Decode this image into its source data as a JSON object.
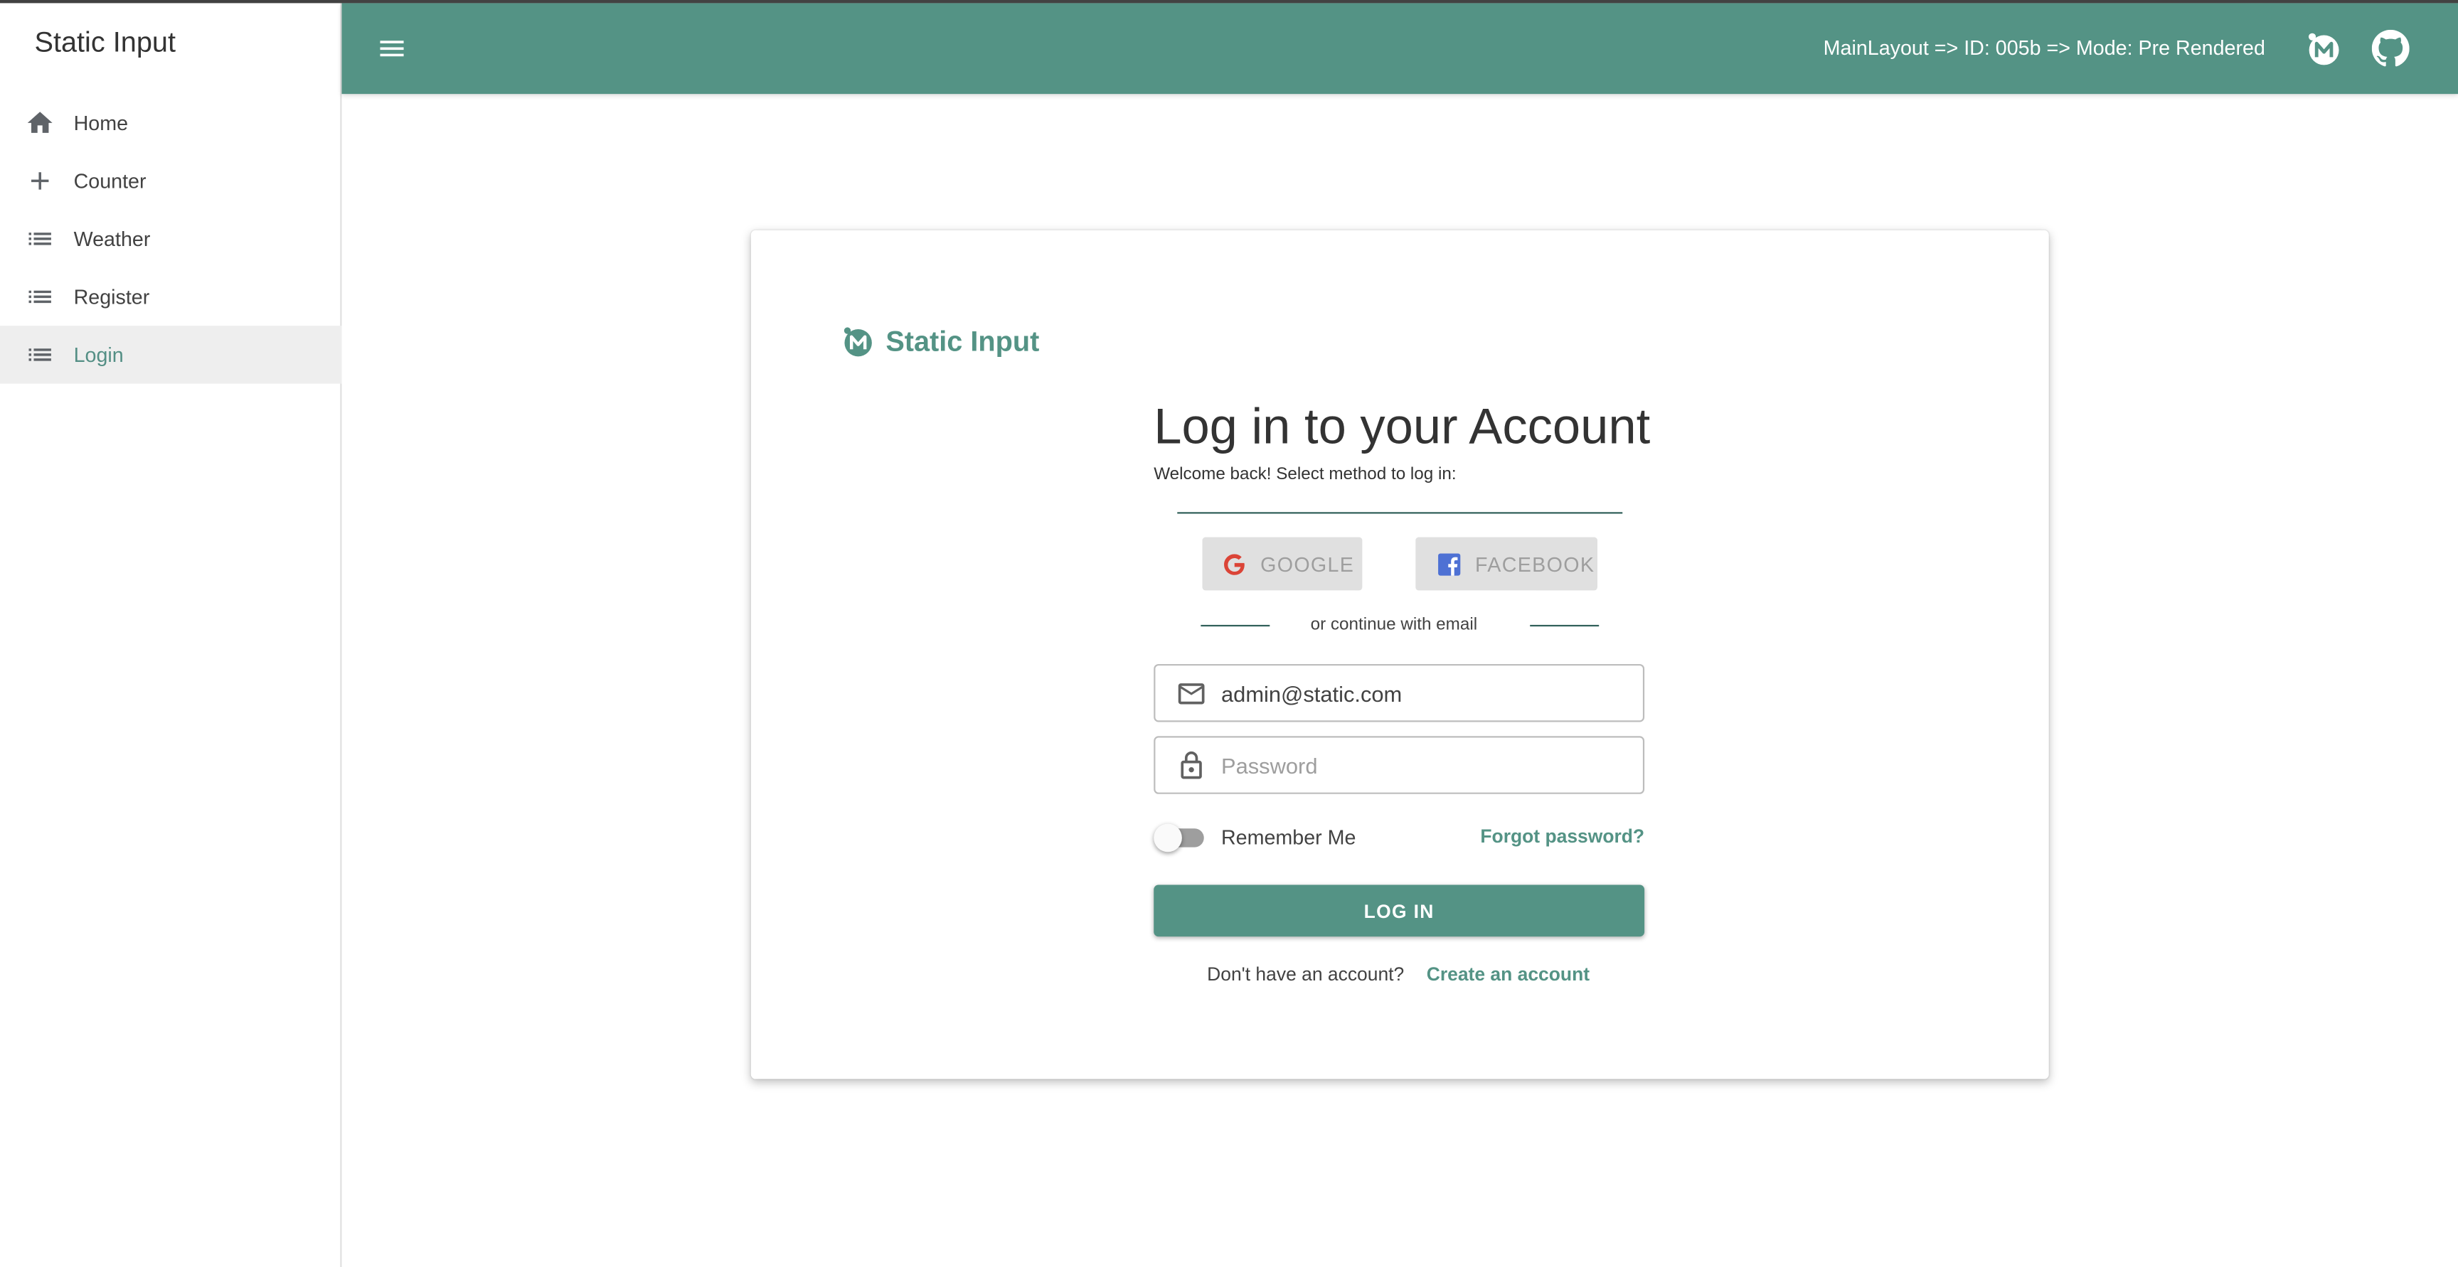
{
  "sidebar": {
    "title": "Static Input",
    "items": [
      {
        "label": "Home",
        "icon": "home-icon"
      },
      {
        "label": "Counter",
        "icon": "plus-icon"
      },
      {
        "label": "Weather",
        "icon": "list-icon"
      },
      {
        "label": "Register",
        "icon": "list-icon"
      },
      {
        "label": "Login",
        "icon": "list-icon",
        "active": true
      }
    ]
  },
  "appbar": {
    "info": "MainLayout => ID: 005b => Mode: Pre Rendered",
    "icons": [
      "menu-icon",
      "static-input-logo-icon",
      "github-icon"
    ]
  },
  "login": {
    "brand": "Static Input",
    "title": "Log in to your Account",
    "subtitle": "Welcome back! Select method to log in:",
    "google_label": "GOOGLE",
    "facebook_label": "FACEBOOK",
    "divider_text": "or continue with email",
    "email_value": "admin@static.com",
    "password_placeholder": "Password",
    "remember_label": "Remember Me",
    "remember_checked": false,
    "forgot_label": "Forgot password?",
    "login_button": "LOG IN",
    "no_account_text": "Don't have an account?",
    "create_account_label": "Create an account"
  },
  "colors": {
    "primary": "#549385",
    "appbar_text": "#ffffff",
    "active_nav_bg": "#eeeeee",
    "google_red": "#db4437",
    "facebook_blue": "#4e71d4"
  }
}
